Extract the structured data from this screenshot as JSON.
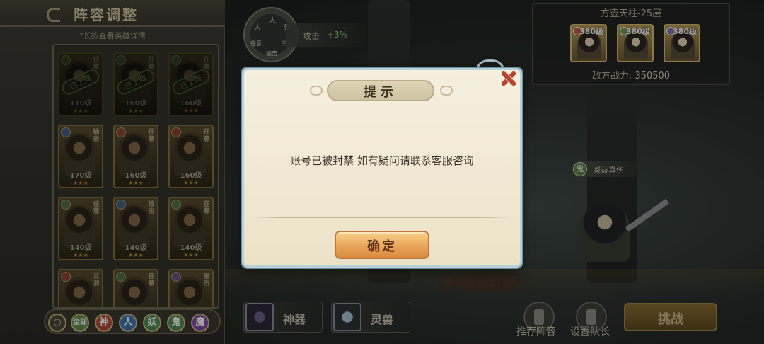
{
  "lineup_panel": {
    "title": "阵容调整",
    "hint": "*长按查看英雄详情",
    "cards": [
      {
        "role": "任意",
        "level": "170级",
        "deployed": "已上阵",
        "faction_color": "#6f9b58"
      },
      {
        "role": "任意",
        "level": "160级",
        "deployed": "已上阵",
        "faction_color": "#6f9b58"
      },
      {
        "role": "任意",
        "level": "160级",
        "deployed": "已上阵",
        "faction_color": "#6f9b58"
      },
      {
        "role": "输击",
        "level": "170级",
        "deployed": "",
        "faction_color": "#5b88b5"
      },
      {
        "role": "任意",
        "level": "160级",
        "deployed": "",
        "faction_color": "#c45c3c"
      },
      {
        "role": "任意",
        "level": "160级",
        "deployed": "",
        "faction_color": "#c45c3c"
      },
      {
        "role": "任意",
        "level": "140级",
        "deployed": "",
        "faction_color": "#6f9b58"
      },
      {
        "role": "输击",
        "level": "140级",
        "deployed": "",
        "faction_color": "#5b88b5"
      },
      {
        "role": "任意",
        "level": "140级",
        "deployed": "",
        "faction_color": "#6f9b58"
      },
      {
        "role": "三消",
        "level": "",
        "deployed": "",
        "faction_color": "#c45c3c"
      },
      {
        "role": "任意",
        "level": "",
        "deployed": "",
        "faction_color": "#6f9b58"
      },
      {
        "role": "输击",
        "level": "",
        "deployed": "",
        "faction_color": "#8b6fb5"
      }
    ],
    "filters": [
      {
        "label": "全部",
        "color": "#5b8f4c"
      },
      {
        "label": "神",
        "color": "#b24a3a"
      },
      {
        "label": "人",
        "color": "#3f73b3"
      },
      {
        "label": "妖",
        "color": "#4d8a55"
      },
      {
        "label": "鬼",
        "color": "#4d8a55"
      },
      {
        "label": "魔",
        "color": "#7d4aa3"
      }
    ]
  },
  "buff": {
    "ring_labels": [
      "人",
      "人",
      "鬼",
      "任意",
      "三消",
      "输击"
    ],
    "label": "攻击",
    "value": "+3%"
  },
  "enemy": {
    "title": "方壶天柱-25层",
    "heroes": [
      {
        "level": "380级",
        "dot_color": "#c45c3c"
      },
      {
        "level": "380级",
        "dot_color": "#6f9b58"
      },
      {
        "level": "380级",
        "dot_color": "#8b6fb5"
      }
    ],
    "power_label": "敌方战力:",
    "power_value": "350500"
  },
  "battle": {
    "reduce_icon": "鬼",
    "reduce_text": "减益真伤",
    "my_power": "217505"
  },
  "bottom": {
    "artifact_label": "神器",
    "beast_label": "灵兽",
    "recommend_label": "推荐阵容",
    "team_label": "设置队长",
    "challenge_label": "挑战"
  },
  "dialog": {
    "title": "提示",
    "message": "账号已被封禁 如有疑问请联系客服咨询",
    "confirm_label": "确定"
  }
}
